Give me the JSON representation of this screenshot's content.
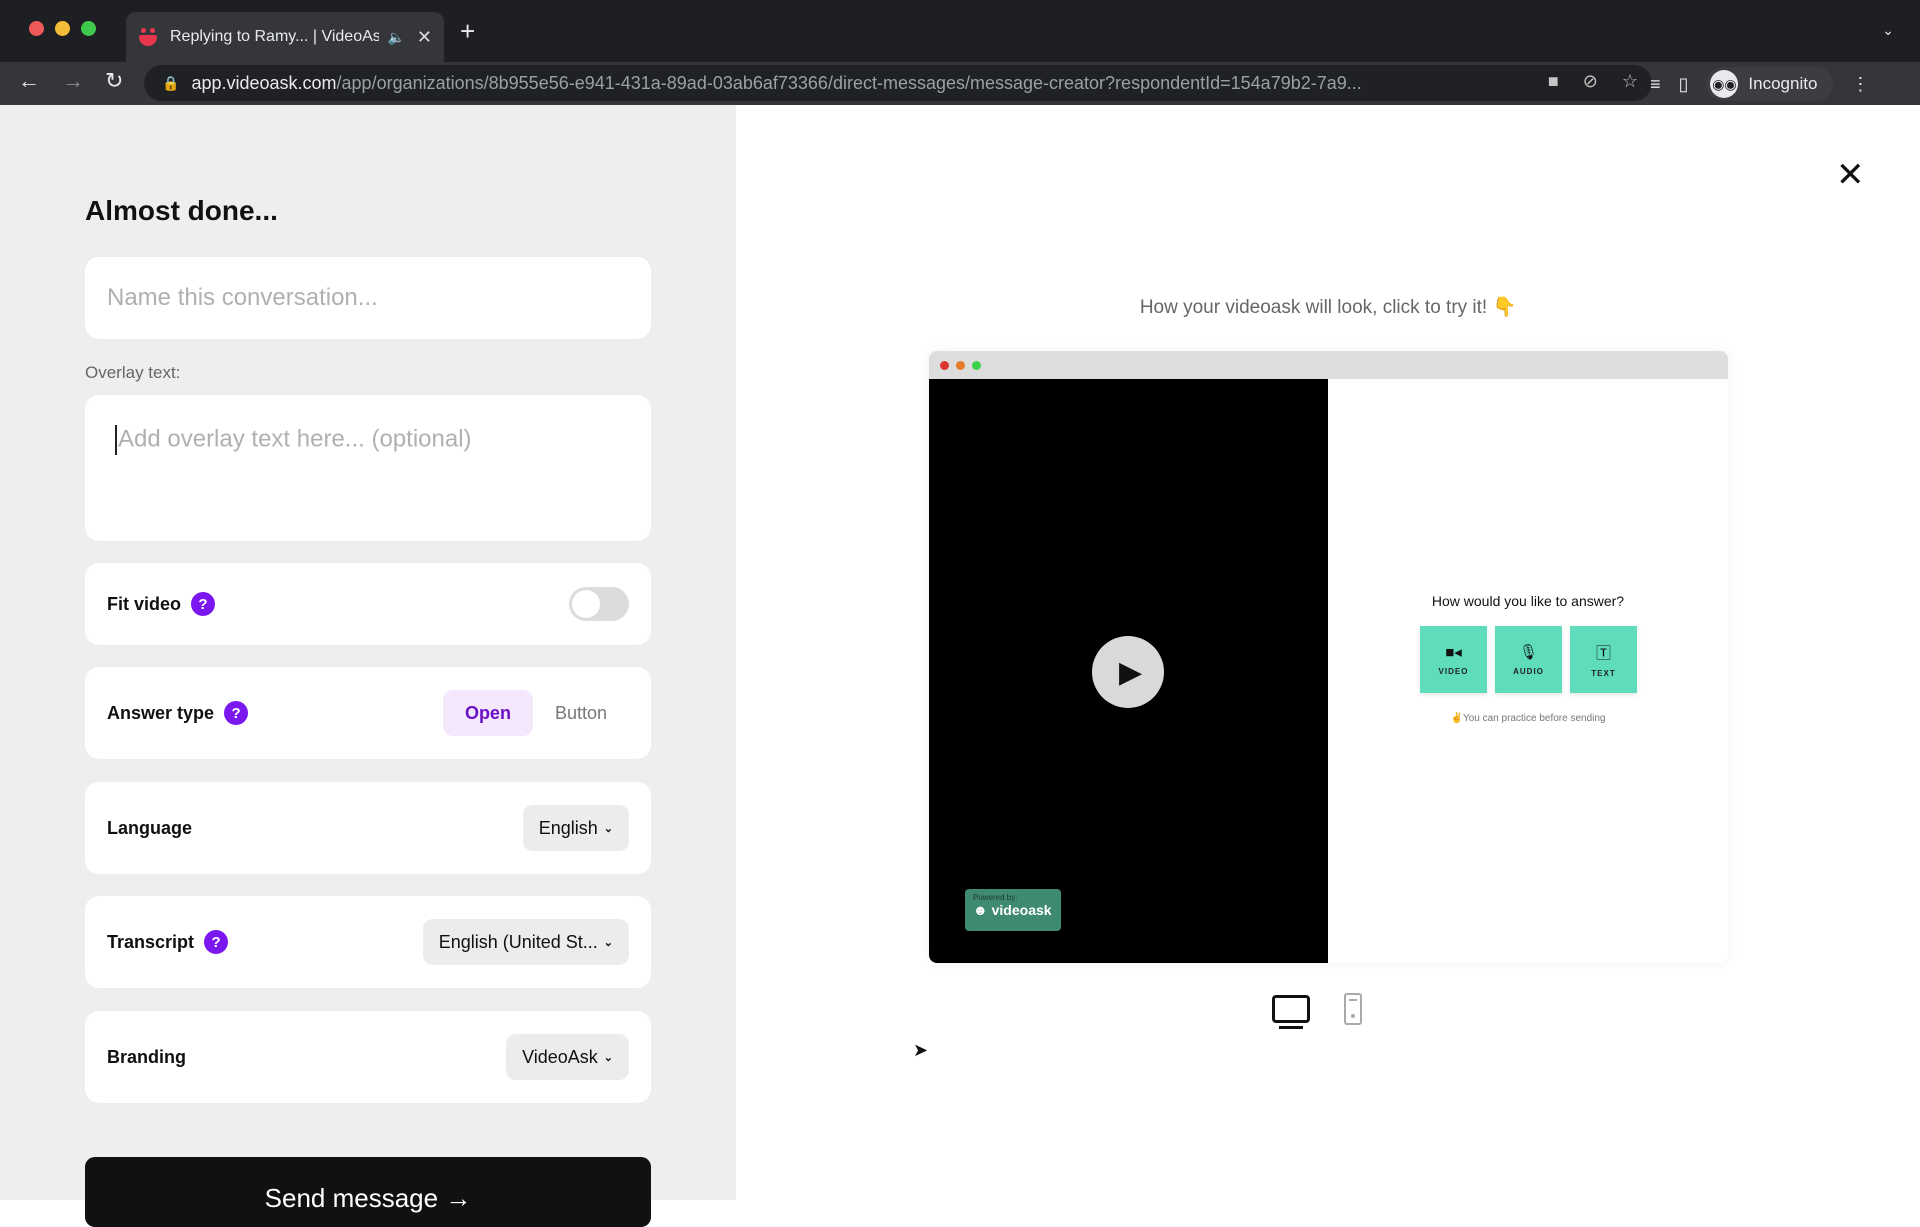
{
  "browser": {
    "tab_title": "Replying to Ramy... | VideoAsk",
    "url_host": "app.videoask.com",
    "url_path": "/app/organizations/8b955e56-e941-431a-89ad-03ab6af73366/direct-messages/message-creator?respondentId=154a79b2-7a9...",
    "profile_label": "Incognito",
    "icons": {
      "back": "arrow-left-icon",
      "forward": "arrow-right-icon",
      "reload": "reload-icon",
      "lock": "lock-icon",
      "camera": "camera-icon",
      "eye_off": "eye-off-icon",
      "star": "star-icon",
      "media": "media-control-icon",
      "sidepanel": "side-panel-icon",
      "menu": "kebab-menu-icon"
    }
  },
  "form": {
    "title": "Almost done...",
    "name_placeholder": "Name this conversation...",
    "overlay_label": "Overlay text:",
    "overlay_placeholder": "Add overlay text here... (optional)",
    "fit_video": {
      "label": "Fit video",
      "enabled": false
    },
    "answer_type": {
      "label": "Answer type",
      "options": [
        "Open",
        "Button"
      ],
      "selected": "Open"
    },
    "language": {
      "label": "Language",
      "value": "English"
    },
    "transcript": {
      "label": "Transcript",
      "value": "English (United St..."
    },
    "branding": {
      "label": "Branding",
      "value": "VideoAsk"
    },
    "send_label": "Send message →",
    "help_glyph": "?"
  },
  "preview": {
    "caption": "How your videoask will look, click to try it! 👇",
    "powered_by": "Powered by:",
    "brand": "videoask",
    "answer_title": "How would you like to answer?",
    "answer_options": [
      {
        "label": "VIDEO",
        "icon": "video-camera-icon"
      },
      {
        "label": "AUDIO",
        "icon": "microphone-icon"
      },
      {
        "label": "TEXT",
        "icon": "text-icon"
      }
    ],
    "practice_note": "✌️You can practice before sending",
    "device_selected": "desktop"
  },
  "accent_colors": {
    "purple": "#7b18f0",
    "answer_green": "#5edcbb",
    "powered_green": "#3f8b72"
  }
}
